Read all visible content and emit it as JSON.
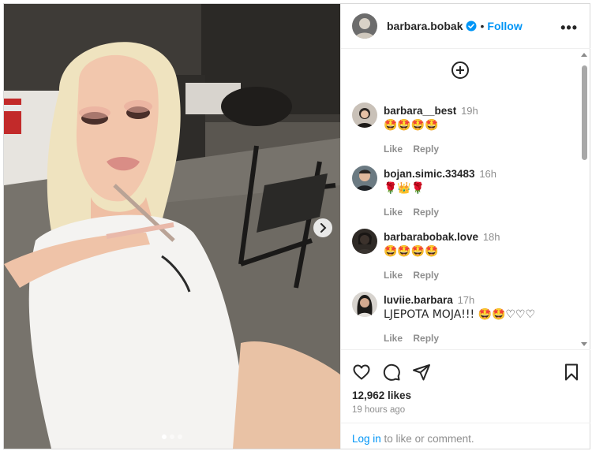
{
  "post": {
    "username": "barbara.bobak",
    "separator": "•",
    "follow_label": "Follow",
    "more_label": "•••",
    "slide_count": 3,
    "active_slide": 1
  },
  "comments": [
    {
      "user": "barbara__best",
      "time": "19h",
      "text": "🤩🤩🤩🤩",
      "like": "Like",
      "reply": "Reply"
    },
    {
      "user": "bojan.simic.33483",
      "time": "16h",
      "text": "🌹👑🌹",
      "like": "Like",
      "reply": "Reply"
    },
    {
      "user": "barbarabobak.love",
      "time": "18h",
      "text": "🤩🤩🤩🤩",
      "like": "Like",
      "reply": "Reply"
    },
    {
      "user": "luviie.barbara",
      "time": "17h",
      "text": "LJEPOTA MOJA!!! 🤩🤩♡♡♡",
      "like": "Like",
      "reply": "Reply"
    }
  ],
  "footer": {
    "likes": "12,962 likes",
    "time_ago": "19 hours ago",
    "login_link": "Log in",
    "login_suffix": " to like or comment."
  },
  "colors": {
    "accent": "#0095f6",
    "text": "#262626",
    "muted": "#8e8e8e"
  },
  "icons": [
    "heart-icon",
    "comment-icon",
    "share-icon",
    "bookmark-icon",
    "add-circle-icon",
    "verified-icon",
    "chevron-right-icon"
  ]
}
